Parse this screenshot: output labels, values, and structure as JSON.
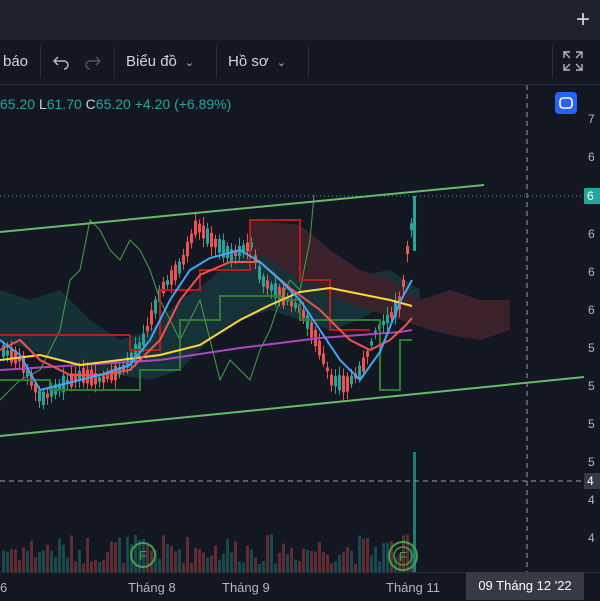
{
  "toolbar": {
    "alerts_label": "báo",
    "chart_type_label": "Biểu đồ",
    "profile_label": "Hồ sơ"
  },
  "legend": {
    "open": "65.20",
    "low_label": "L",
    "low": "61.70",
    "close_label": "C",
    "close": "65.20",
    "change": "+4.20",
    "change_pct": "(+6.89%)"
  },
  "price_axis": {
    "ticks": [
      "7",
      "6",
      "6",
      "6",
      "6",
      "5",
      "5",
      "5",
      "5",
      "4",
      "4",
      "4"
    ],
    "last_price": "6",
    "crosshair_price": "4"
  },
  "time_axis": {
    "labels": [
      "6",
      "Tháng 8",
      "Tháng 9",
      "Tháng 11"
    ],
    "crosshair_date": "09 Tháng 12 '22"
  },
  "events": [
    "F",
    "F"
  ],
  "colors": {
    "up": "#26a69a",
    "down": "#ef5350",
    "channel": "#66bb6a",
    "accent": "#2962ff"
  }
}
